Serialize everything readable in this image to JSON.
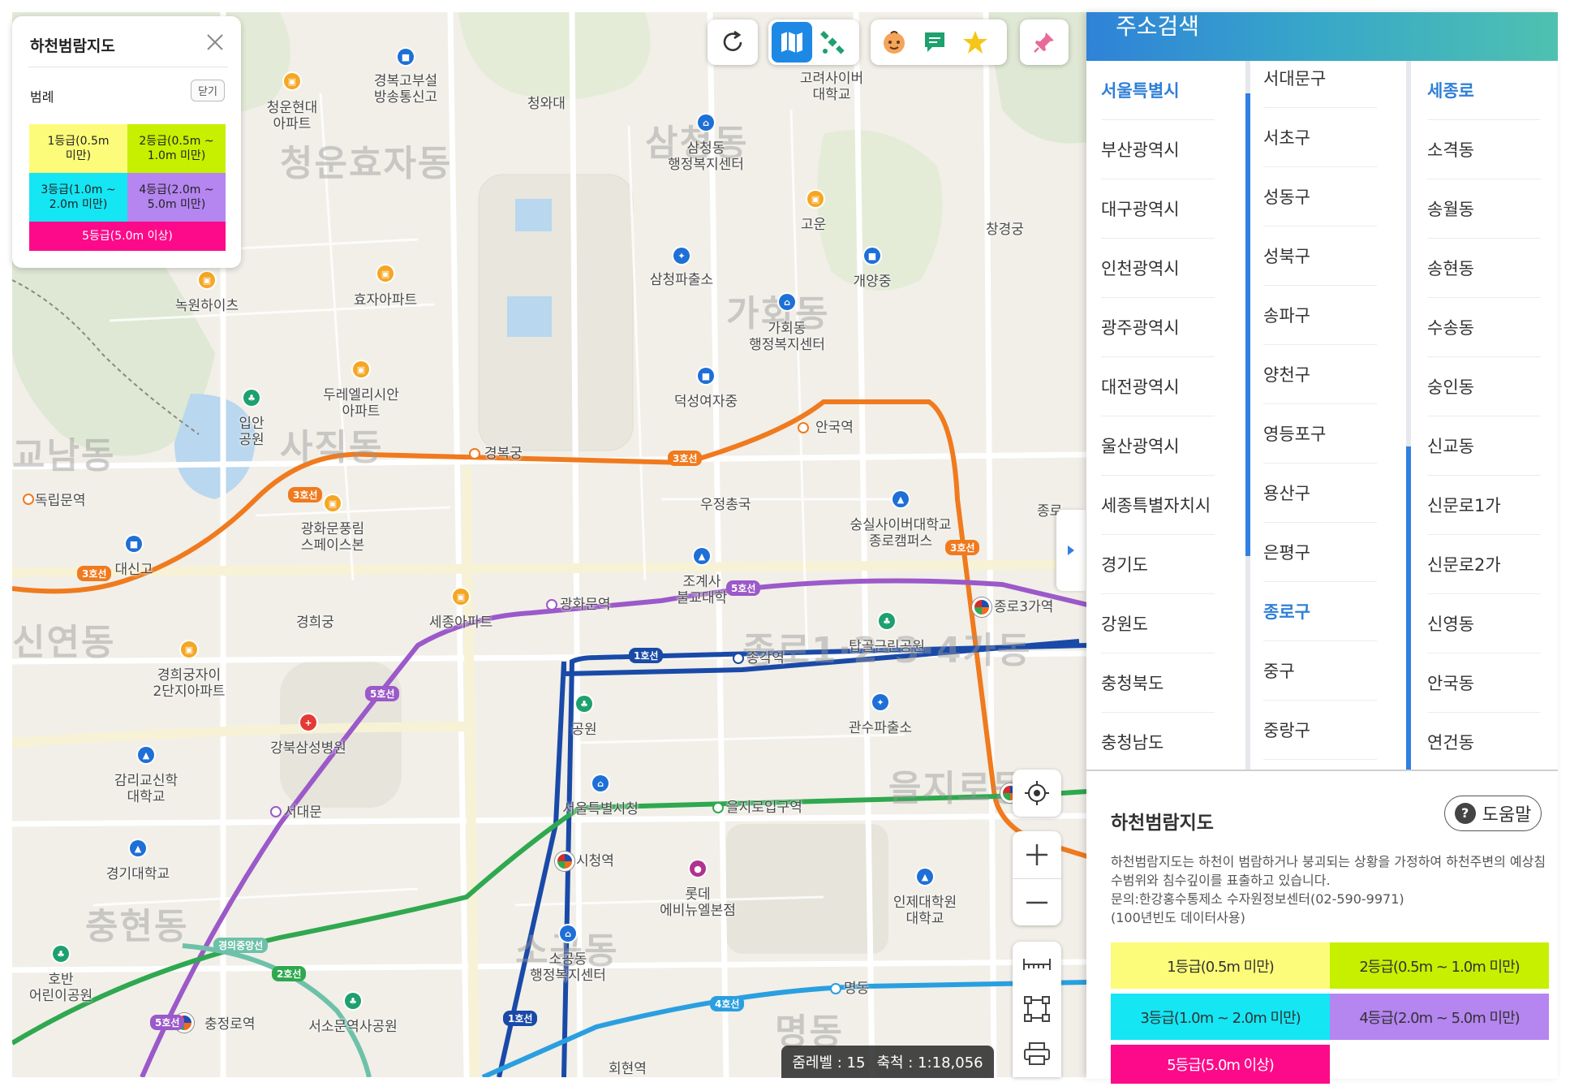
{
  "map": {
    "areas": [
      "청운효자동",
      "삼청동",
      "가회동",
      "사직동",
      "종로1·2·3·4가동",
      "을지로동",
      "소공동",
      "명동",
      "충현동",
      "교남동",
      "신연동"
    ],
    "labels": [
      {
        "id": "l1",
        "text": "경복고부설\n방송통신고"
      },
      {
        "id": "l2",
        "text": "청운현대\n아파트"
      },
      {
        "id": "l3",
        "text": "청와대"
      },
      {
        "id": "l4",
        "text": "고려사이버\n대학교"
      },
      {
        "id": "l5",
        "text": "삼청동\n행정복지센터"
      },
      {
        "id": "l6",
        "text": "고운"
      },
      {
        "id": "l7",
        "text": "창경궁"
      },
      {
        "id": "l8",
        "text": "삼청파출소"
      },
      {
        "id": "l9",
        "text": "개양중"
      },
      {
        "id": "l10",
        "text": "녹원하이츠"
      },
      {
        "id": "l11",
        "text": "효자아파트"
      },
      {
        "id": "l12",
        "text": "가회동\n행정복지센터"
      },
      {
        "id": "l13",
        "text": "두레엘리시안\n아파트"
      },
      {
        "id": "l14",
        "text": "덕성여자중"
      },
      {
        "id": "l15",
        "text": "입안\n공원"
      },
      {
        "id": "l16",
        "text": "안국역"
      },
      {
        "id": "l17",
        "text": "경복궁"
      },
      {
        "id": "l18",
        "text": "독립문역"
      },
      {
        "id": "l19",
        "text": "광화문풍림\n스페이스본"
      },
      {
        "id": "l20",
        "text": "우정총국"
      },
      {
        "id": "l21",
        "text": "숭실사이버대학교\n종로캠퍼스"
      },
      {
        "id": "l22",
        "text": "대신고"
      },
      {
        "id": "l23",
        "text": "조계사\n불교대학"
      },
      {
        "id": "l24",
        "text": "광화문역"
      },
      {
        "id": "l25",
        "text": "세종아파트"
      },
      {
        "id": "l26",
        "text": "경희궁"
      },
      {
        "id": "l27",
        "text": "종로3가역"
      },
      {
        "id": "l28",
        "text": "탑골근린공원"
      },
      {
        "id": "l29",
        "text": "종각역"
      },
      {
        "id": "l30",
        "text": "경희궁자이\n2단지아파트"
      },
      {
        "id": "l31",
        "text": "강북삼성병원"
      },
      {
        "id": "l32",
        "text": "공원"
      },
      {
        "id": "l33",
        "text": "관수파출소"
      },
      {
        "id": "l34",
        "text": "감리교신학\n대학교"
      },
      {
        "id": "l35",
        "text": "서대문"
      },
      {
        "id": "l36",
        "text": "서울특별시청"
      },
      {
        "id": "l37",
        "text": "을지로입구역"
      },
      {
        "id": "l38",
        "text": "경기대학교"
      },
      {
        "id": "l39",
        "text": "시청역"
      },
      {
        "id": "l40",
        "text": "롯데\n에비뉴엘본점"
      },
      {
        "id": "l41",
        "text": "인제대학원\n대학교"
      },
      {
        "id": "l42",
        "text": "소공동\n행정복지센터"
      },
      {
        "id": "l43",
        "text": "호반\n어린이공원"
      },
      {
        "id": "l44",
        "text": "충정로역"
      },
      {
        "id": "l45",
        "text": "서소문역사공원"
      },
      {
        "id": "l46",
        "text": "명동"
      },
      {
        "id": "l47",
        "text": "회현역"
      },
      {
        "id": "l48",
        "text": "종로"
      }
    ],
    "line_tags": [
      "3호선",
      "3호선",
      "3호선",
      "3호선",
      "5호선",
      "5호선",
      "5호선",
      "1호선",
      "1호선",
      "2호선",
      "4호선",
      "경의중앙선"
    ]
  },
  "toolbar": {
    "refresh_icon": "refresh-icon",
    "map_icon": "map-icon",
    "satellite_icon": "satellite-icon",
    "kid_icon": "kid-icon",
    "chat_icon": "chat-icon",
    "star_icon": "star-icon",
    "pin_icon": "pin-icon"
  },
  "legend": {
    "title": "하천범람지도",
    "subtitle": "범례",
    "close_label": "닫기",
    "grades": [
      {
        "label": "1등급(0.5m\n미만)",
        "color": "#fcfc7a"
      },
      {
        "label": "2등급(0.5m ~\n1.0m 미만)",
        "color": "#c6f000"
      },
      {
        "label": "3등급(1.0m ~\n2.0m 미만)",
        "color": "#14e6f4"
      },
      {
        "label": "4등급(2.0m ~\n5.0m 미만)",
        "color": "#b585f0"
      },
      {
        "label": "5등급(5.0m 이상)",
        "color": "#fc0a8a"
      }
    ]
  },
  "panel": {
    "title": "주소검색",
    "col1": [
      "서울특별시",
      "부산광역시",
      "대구광역시",
      "인천광역시",
      "광주광역시",
      "대전광역시",
      "울산광역시",
      "세종특별자치시",
      "경기도",
      "강원도",
      "충청북도",
      "충청남도"
    ],
    "col1_selected": "서울특별시",
    "col2": [
      "서대문구",
      "서초구",
      "성동구",
      "성북구",
      "송파구",
      "양천구",
      "영등포구",
      "용산구",
      "은평구",
      "종로구",
      "중구",
      "중랑구"
    ],
    "col2_selected": "종로구",
    "col3": [
      "세종로",
      "소격동",
      "송월동",
      "송현동",
      "수송동",
      "숭인동",
      "신교동",
      "신문로1가",
      "신문로2가",
      "신영동",
      "안국동",
      "연건동"
    ],
    "col3_selected": "세종로",
    "info": {
      "title": "하천범람지도",
      "help_label": "도움말",
      "desc1": "하천범람지도는 하천이 범람하거나 붕괴되는 상황을 가정하여 하천주변의 예상침수범위와 침수깊이를 표출하고 있습니다.",
      "desc2": "문의:한강홍수통제소 수자원정보센터(02-590-9971)",
      "desc3": "(100년빈도 데이터사용)",
      "grades": [
        {
          "label": "1등급(0.5m 미만)",
          "color": "#fcfc7a"
        },
        {
          "label": "2등급(0.5m ~ 1.0m 미만)",
          "color": "#c6f000"
        },
        {
          "label": "3등급(1.0m ~ 2.0m 미만)",
          "color": "#14e6f4"
        },
        {
          "label": "4등급(2.0m ~ 5.0m 미만)",
          "color": "#b585f0"
        },
        {
          "label": "5등급(5.0m 이상)",
          "color": "#fc0a8a"
        }
      ]
    }
  },
  "status": {
    "zoom_label": "줌레벨 : 15",
    "scale_label": "축척 : 1:18,056"
  },
  "colors": {
    "line1": "#1a4aa8",
    "line2": "#2fa84f",
    "line3": "#f07a1e",
    "line4": "#2a9fe0",
    "line5": "#9b59c9",
    "accent": "#2f7fd8"
  }
}
